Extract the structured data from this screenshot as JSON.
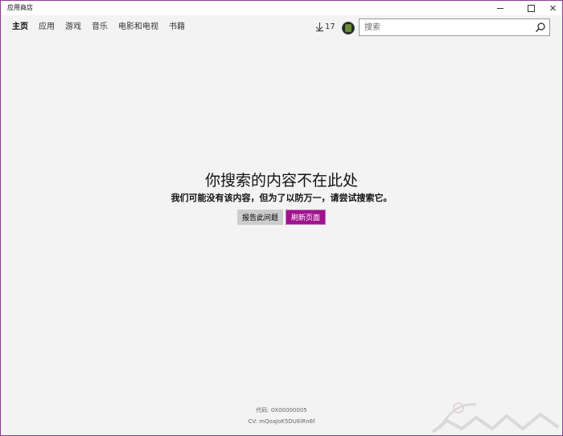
{
  "window": {
    "title": "应用商店"
  },
  "nav": {
    "items": [
      "主页",
      "应用",
      "游戏",
      "音乐",
      "电影和电视",
      "书籍"
    ],
    "active_index": 0
  },
  "downloads": {
    "count": "17"
  },
  "search": {
    "placeholder": "搜索",
    "value": ""
  },
  "message": {
    "heading": "你搜索的内容不在此处",
    "body": "我们可能没有该内容，但为了以防万一，请尝试搜索它。"
  },
  "buttons": {
    "report": "报告此问题",
    "refresh": "刷新页面"
  },
  "error": {
    "code": "代码: 0X00000005",
    "cv": "CV: mQoaJoK5DU6lRn6f"
  },
  "colors": {
    "accent": "#a0138e",
    "window_border": "#8e3b8e",
    "background": "#f3f3f3"
  },
  "icons": {
    "download": "download-icon",
    "search": "search-icon",
    "minimize": "minimize-icon",
    "maximize": "maximize-icon",
    "close": "close-icon"
  }
}
